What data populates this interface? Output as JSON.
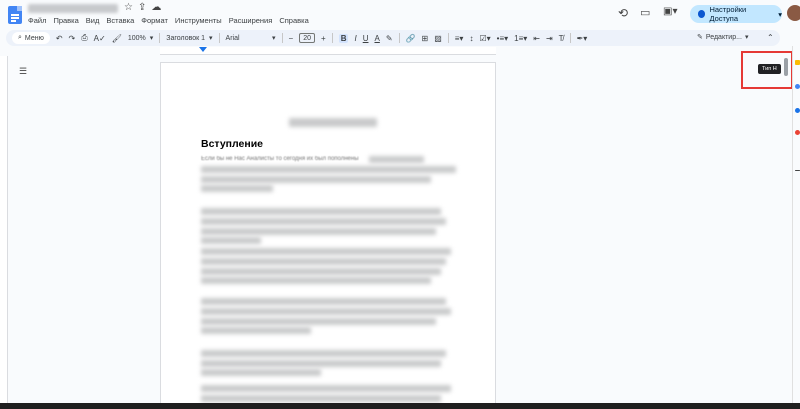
{
  "menu": [
    "Файл",
    "Правка",
    "Вид",
    "Вставка",
    "Формат",
    "Инструменты",
    "Расширения",
    "Справка"
  ],
  "header": {
    "share_label": "Настройки Доступа"
  },
  "toolbar": {
    "menu_label": "Меню",
    "zoom": "100%",
    "style": "Заголовок 1",
    "font": "Arial",
    "font_size": "20",
    "edit_mode": "Редактир..."
  },
  "document": {
    "heading": "Вступление",
    "first_line": "Если бы не Нас Аналисты то сегодня их был пополнены"
  },
  "tooltip": {
    "text": "Тип Н"
  },
  "colors": {
    "accent": "#1a73e8",
    "share_bg": "#c2e7ff",
    "highlight_box": "#e53935"
  }
}
